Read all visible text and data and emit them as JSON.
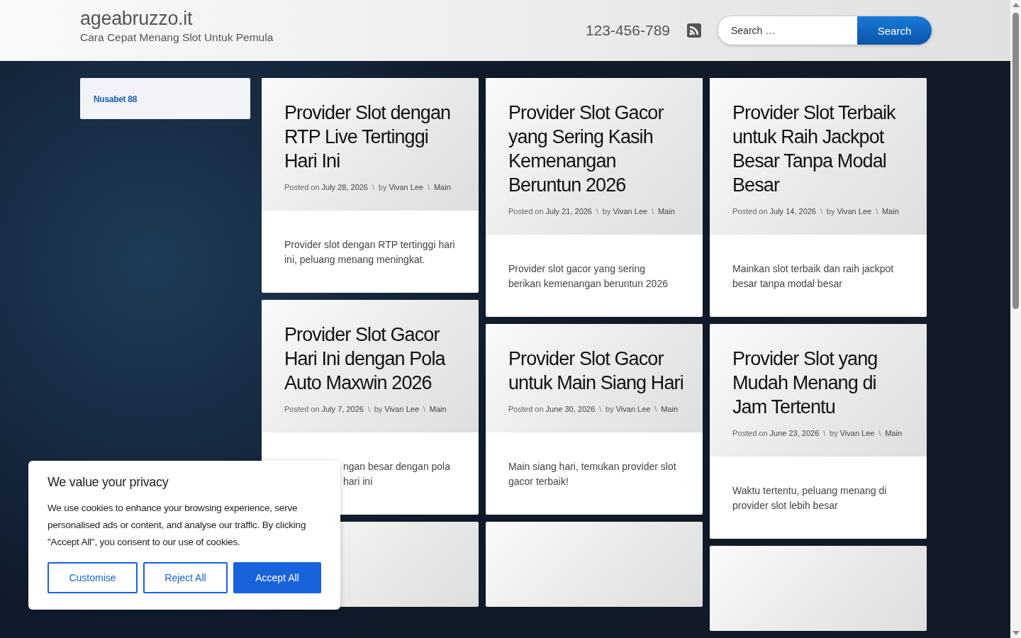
{
  "header": {
    "site_title": "ageabruzzo.it",
    "tagline": "Cara Cepat Menang Slot Untuk Pemula",
    "phone": "123-456-789",
    "search": {
      "placeholder": "Search …",
      "button": "Search"
    }
  },
  "sidebar": {
    "items": [
      {
        "label": "Nusabet 88"
      }
    ]
  },
  "columns": [
    {
      "posts": [
        {
          "kind": "full",
          "title": "Provider Slot dengan RTP Live Tertinggi Hari Ini",
          "separator": "\\",
          "posted_label": "Posted on",
          "date": "July 28, 2026",
          "by_label": "by",
          "author": "Vivan Lee",
          "category": "Main",
          "excerpt": [
            "Provider slot dengan RTP tertinggi hari ini, peluang menang meningkat."
          ]
        },
        {
          "kind": "covered",
          "title": "Provider Slot Gacor Hari Ini dengan Pola Auto Maxwin 2026",
          "separator": "\\",
          "posted_label": "Posted on",
          "date": "July 7, 2026",
          "by_label": "by",
          "author": "Vivan Lee",
          "category": "Main",
          "excerpt": [
            "ngan besar dengan pola",
            "hari ini"
          ]
        },
        {
          "kind": "blank"
        }
      ]
    },
    {
      "posts": [
        {
          "kind": "full",
          "title": "Provider Slot Gacor yang Sering Kasih Kemenangan Beruntun 2026",
          "separator": "\\",
          "posted_label": "Posted on",
          "date": "July 21, 2026",
          "by_label": "by",
          "author": "Vivan Lee",
          "category": "Main",
          "excerpt": [
            "Provider slot gacor yang sering berikan kemenangan beruntun 2026"
          ]
        },
        {
          "kind": "full",
          "title": "Provider Slot Gacor untuk Main Siang Hari",
          "separator": "\\",
          "posted_label": "Posted on",
          "date": "June 30, 2026",
          "by_label": "by",
          "author": "Vivan Lee",
          "category": "Main",
          "excerpt": [
            "Main siang hari, temukan provider slot gacor terbaik!"
          ]
        },
        {
          "kind": "blank"
        }
      ]
    },
    {
      "posts": [
        {
          "kind": "full",
          "title": "Provider Slot Terbaik untuk Raih Jackpot Besar Tanpa Modal Besar",
          "separator": "\\",
          "posted_label": "Posted on",
          "date": "July 14, 2026",
          "by_label": "by",
          "author": "Vivan Lee",
          "category": "Main",
          "excerpt": [
            "Mainkan slot terbaik dan raih jackpot besar tanpa modal besar"
          ]
        },
        {
          "kind": "full",
          "title": "Provider Slot yang Mudah Menang di Jam Tertentu",
          "separator": "\\",
          "posted_label": "Posted on",
          "date": "June 23, 2026",
          "by_label": "by",
          "author": "Vivan Lee",
          "category": "Main",
          "excerpt": [
            "Waktu tertentu, peluang menang di provider slot lebih besar"
          ]
        },
        {
          "kind": "blank"
        }
      ]
    }
  ],
  "cookie_notice": {
    "title": "We value your privacy",
    "text": "We use cookies to enhance your browsing experience, serve personalised ads or content, and analyse our traffic. By clicking \"Accept All\", you consent to our use of cookies.",
    "buttons": [
      {
        "label": "Customise",
        "kind": "outline"
      },
      {
        "label": "Reject All",
        "kind": "outline"
      },
      {
        "label": "Accept All",
        "kind": "primary"
      }
    ]
  }
}
